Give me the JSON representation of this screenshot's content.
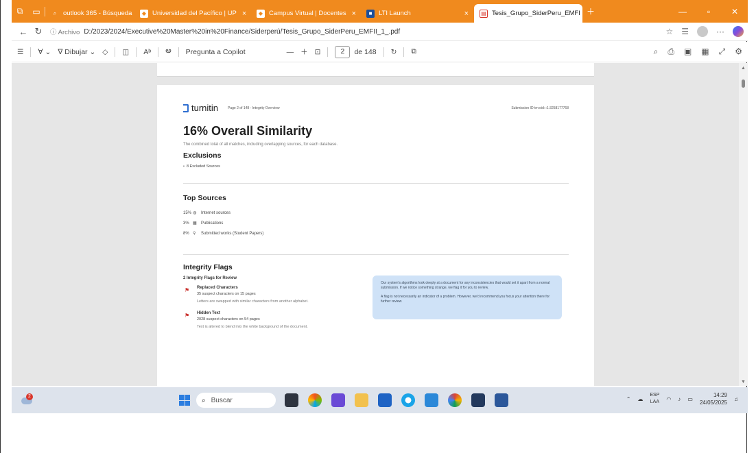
{
  "browser": {
    "tabs": [
      {
        "label": "outlook 365 - Búsqueda",
        "icon": "search-icon",
        "active": false
      },
      {
        "label": "Universidad del Pacífico | UP",
        "icon": "site-icon",
        "active": false
      },
      {
        "label": "Campus Virtual | Docentes",
        "icon": "site-icon",
        "active": false
      },
      {
        "label": "LTI Launch",
        "icon": "lti-icon",
        "active": false
      },
      {
        "label": "Tesis_Grupo_SiderPeru_EMFI",
        "icon": "pdf-icon",
        "active": true
      }
    ],
    "address": {
      "chip": "Archivo",
      "url": "D:/2023/2024/Executive%20Master%20in%20Finance/Siderperú/Tesis_Grupo_SiderPeru_EMFII_1_.pdf"
    }
  },
  "pdf_toolbar": {
    "draw_label": "Dibujar",
    "copilot_label": "Pregunta a Copilot",
    "page_current": "2",
    "page_total": "de 148"
  },
  "page": {
    "logo_text": "turnitin",
    "page_info": "Page 2 of 148 - Integrity Overview",
    "submission_id": "Submission ID trn:oid:::1:3258177768",
    "title": "16% Overall Similarity",
    "description": "The combined total of all matches, including overlapping sources, for each database.",
    "exclusions_heading": "Exclusions",
    "exclusions_item": "8 Excluded Sources",
    "top_sources_heading": "Top Sources",
    "sources": [
      {
        "pct": "15%",
        "icon": "globe-icon",
        "label": "Internet sources"
      },
      {
        "pct": "3%",
        "icon": "publications-icon",
        "label": "Publications"
      },
      {
        "pct": "8%",
        "icon": "user-icon",
        "label": "Submitted works (Student Papers)"
      }
    ],
    "integrity_heading": "Integrity Flags",
    "integrity_sub": "2 Integrity Flags for Review",
    "flags": [
      {
        "title": "Replaced Characters",
        "line": "35 suspect characters on 15 pages",
        "detail": "Letters are swapped with similar characters from another alphabet."
      },
      {
        "title": "Hidden Text",
        "line": "2028 suspect characters on 54 pages",
        "detail": "Text is altered to blend into the white background of the document."
      }
    ],
    "info_p1": "Our system's algorithms look deeply at a document for any inconsistencies that would set it apart from a normal submission. If we notice something strange, we flag it for you to review.",
    "info_p2": "A flag is not necessarily an indicator of a problem. However, we'd recommend you focus your attention there for further review."
  },
  "taskbar": {
    "weather_badge": "2",
    "search_placeholder": "Buscar",
    "lang_top": "ESP",
    "lang_bottom": "LAA",
    "time": "14:29",
    "date": "24/05/2025"
  },
  "colors": {
    "tabbar": "#f08a1e",
    "flag": "#c9302c",
    "infobox": "#cfe2f7",
    "turnitin_blue": "#2f6fd1"
  }
}
